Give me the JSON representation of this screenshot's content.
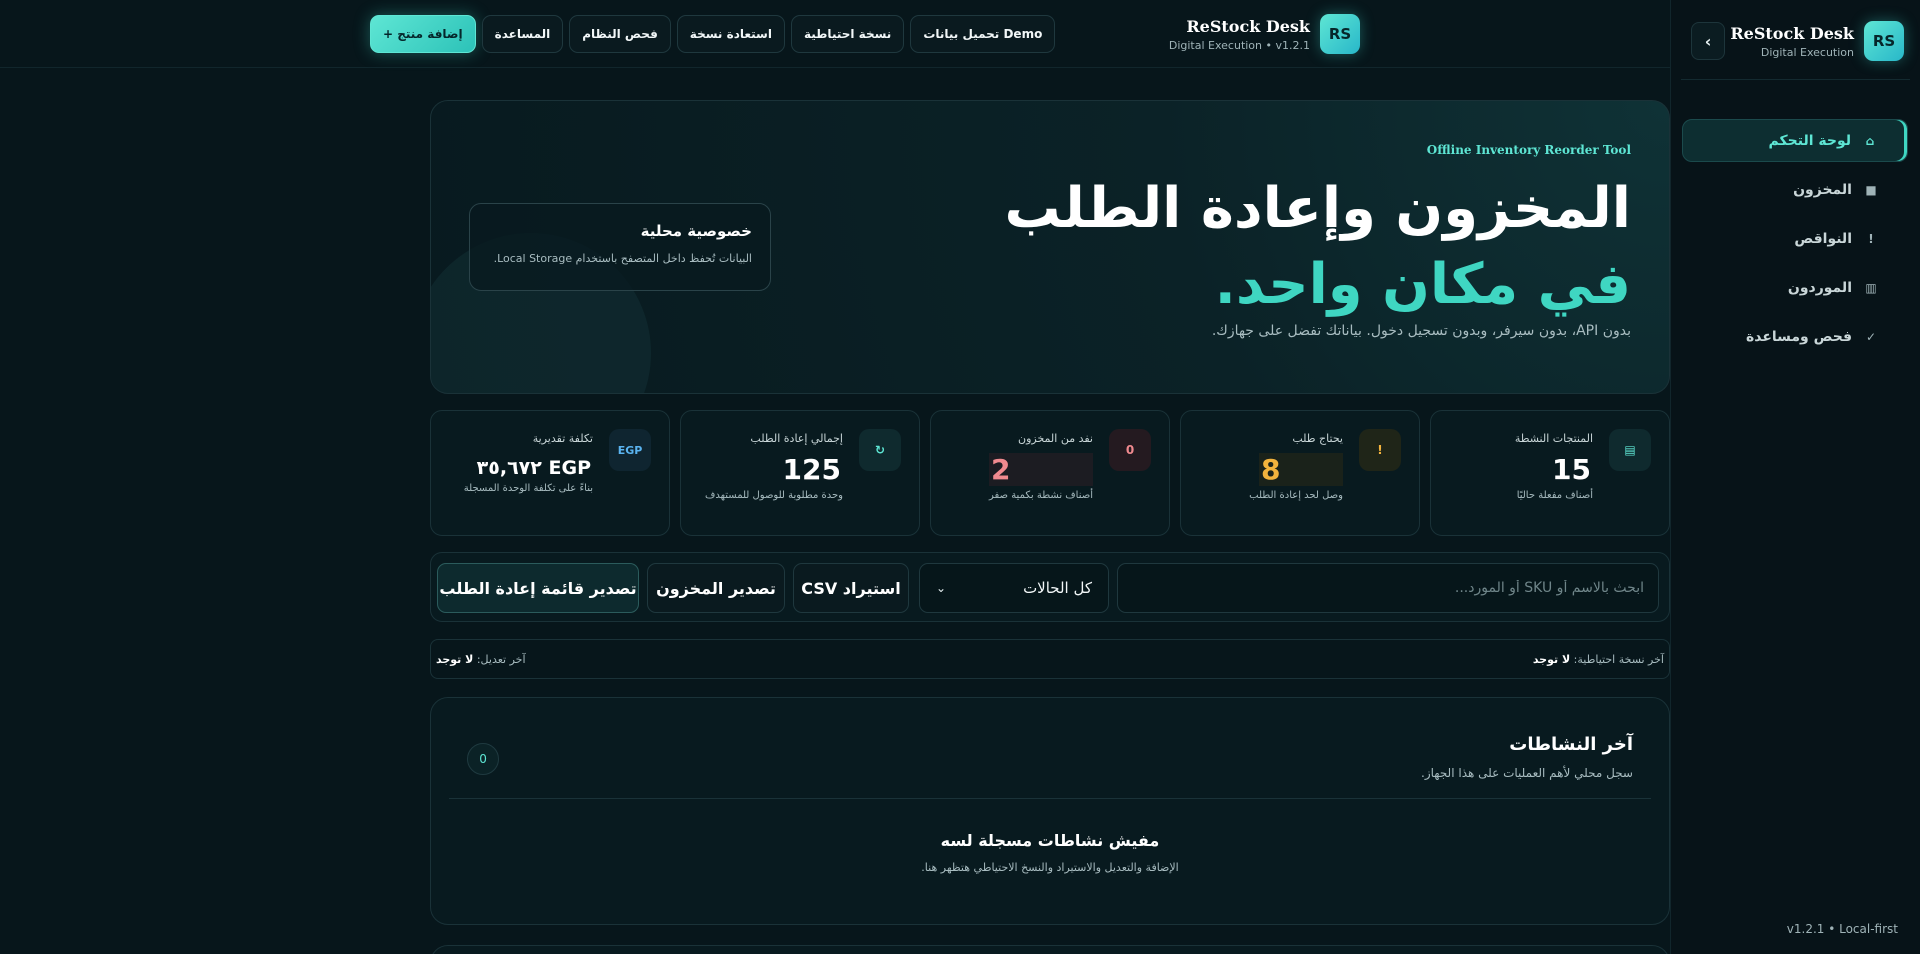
{
  "sidebar": {
    "logo": "RS",
    "title": "ReStock Desk",
    "subtitle": "Digital Execution",
    "collapse_icon": "chevron-right-icon",
    "items": [
      {
        "label": "لوحة التحكم",
        "icon": "⌂"
      },
      {
        "label": "المخزون",
        "icon": "■"
      },
      {
        "label": "النواقص",
        "icon": "!"
      },
      {
        "label": "الموردون",
        "icon": "▥"
      },
      {
        "label": "فحص ومساعدة",
        "icon": "✓"
      }
    ],
    "footer": "v1.2.1 • Local-first"
  },
  "topbar": {
    "logo": "RS",
    "title": "ReStock Desk",
    "subtitle": "Digital Execution • v1.2.1",
    "buttons": {
      "demo": "تحميل بيانات Demo",
      "backup": "نسخة احتياطية",
      "restore": "استعادة نسخة",
      "system_check": "فحص النظام",
      "help": "المساعدة",
      "add_product": "+ إضافة منتج"
    }
  },
  "hero": {
    "eyebrow": "Offline Inventory Reorder Tool",
    "title_line1": "المخزون وإعادة الطلب",
    "title_line2": "في مكان واحد.",
    "description": "بدون API، بدون سيرفر، وبدون تسجيل دخول. بياناتك تفضل على جهازك.",
    "privacy_title": "خصوصية محلية",
    "privacy_text": "البيانات تُحفظ داخل المتصفح باستخدام Local Storage."
  },
  "stats": [
    {
      "label": "المنتجات النشطة",
      "value": "15",
      "sub": "أصناف مفعلة حاليًا",
      "icon": "▤",
      "color": "#ffffff",
      "icon_color": "#5ee6d4"
    },
    {
      "label": "يحتاج طلب",
      "value": "8",
      "sub": "وصل لحد إعادة الطلب",
      "icon": "!",
      "color": "#f2b33d",
      "icon_color": "#f2b33d"
    },
    {
      "label": "نفد من المخزون",
      "value": "2",
      "sub": "أصناف نشطة بكمية صفر",
      "icon": "0",
      "color": "#f08a8f",
      "icon_color": "#f08a8f"
    },
    {
      "label": "إجمالي إعادة الطلب",
      "value": "125",
      "sub": "وحدة مطلوبة للوصول للمستهدف",
      "icon": "↻",
      "color": "#ffffff",
      "icon_color": "#5ee6d4"
    },
    {
      "label": "تكلفة تقديرية",
      "value": "EGP ٣٥,٦٧٢",
      "sub": "بناءً على تكلفة الوحدة المسجلة",
      "icon": "EGP",
      "color": "#ffffff",
      "icon_color": "#5ab4f0"
    }
  ],
  "toolbar": {
    "search_placeholder": "ابحث بالاسم أو SKU أو المورد...",
    "status_value": "كل الحالات",
    "import_csv": "استيراد CSV",
    "export_inventory": "تصدير المخزون",
    "export_reorder": "تصدير قائمة إعادة الطلب"
  },
  "meta": {
    "last_backup_label": "آخر نسخة احتياطية:",
    "last_backup_value": "لا توجد",
    "last_edit_label": "آخر تعديل:",
    "last_edit_value": "لا توجد"
  },
  "activity": {
    "title": "آخر النشاطات",
    "subtitle": "سجل محلي لأهم العمليات على هذا الجهاز.",
    "count": "0",
    "empty_title": "مفيش نشاطات مسجلة لسه",
    "empty_text": "الإضافة والتعديل والاستيراد والنسخ الاحتياطي هتظهر هنا."
  }
}
